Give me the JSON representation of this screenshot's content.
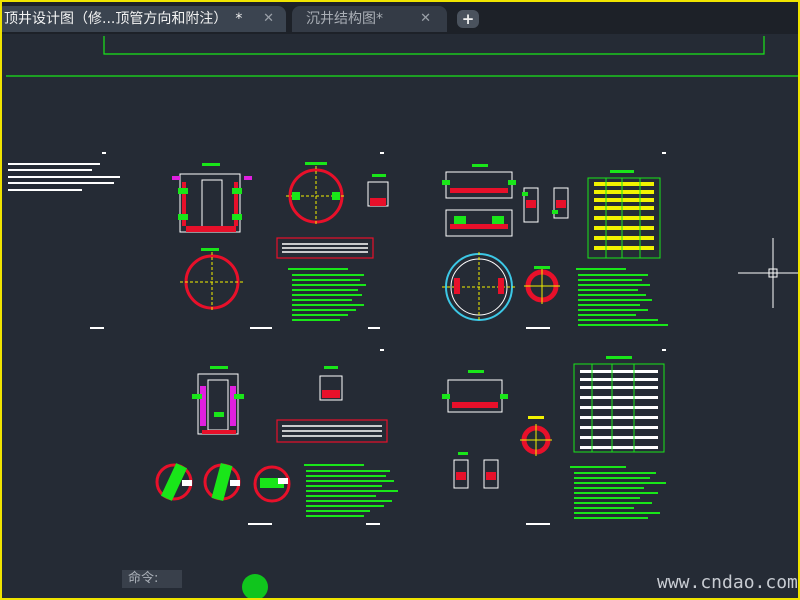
{
  "tabs": [
    {
      "label": "顶井设计图（修...顶管方向和附注）",
      "modified": "*",
      "close": "✕"
    },
    {
      "label": "沉井结构图*",
      "close": "✕"
    }
  ],
  "add_tab": "+",
  "command_label": "命令:",
  "watermark": "www.cndao.com",
  "colors": {
    "border": "#f0e400",
    "canvas": "#252b35",
    "cad_green": "#19e619",
    "cad_red": "#e8102a",
    "cad_yellow": "#f2f200",
    "cad_magenta": "#e020e0",
    "cad_cyan": "#3cc8e6"
  }
}
